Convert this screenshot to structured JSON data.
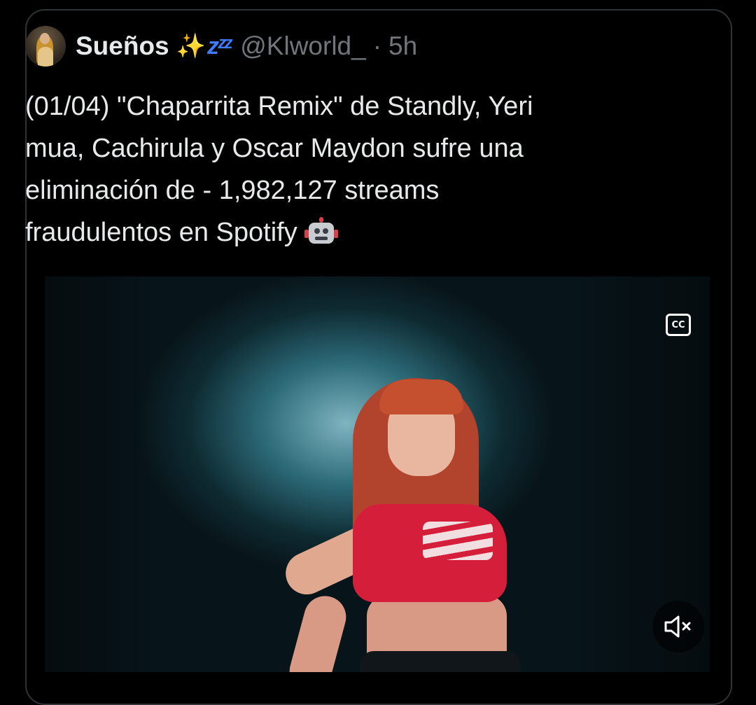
{
  "tweet": {
    "display_name": "Sueños",
    "name_emojis": [
      "✨",
      "💤"
    ],
    "handle": "@Klworld_",
    "separator": "·",
    "time": "5h",
    "text_lines": [
      "(01/04) \"Chaparrita Remix\" de Standly, Yeri",
      "mua, Cachirula y Oscar Maydon sufre una",
      "eliminación de - 1,982,127 streams",
      "fraudulentos en Spotify"
    ],
    "text_emoji": "robot-face"
  },
  "video": {
    "cc_label": "CC",
    "mute_icon": "speaker-muted-icon",
    "cc_icon": "closed-captions-icon"
  },
  "colors": {
    "background": "#000000",
    "text_primary": "#e7e9ea",
    "text_secondary": "#71767b",
    "border": "#2f3336"
  }
}
